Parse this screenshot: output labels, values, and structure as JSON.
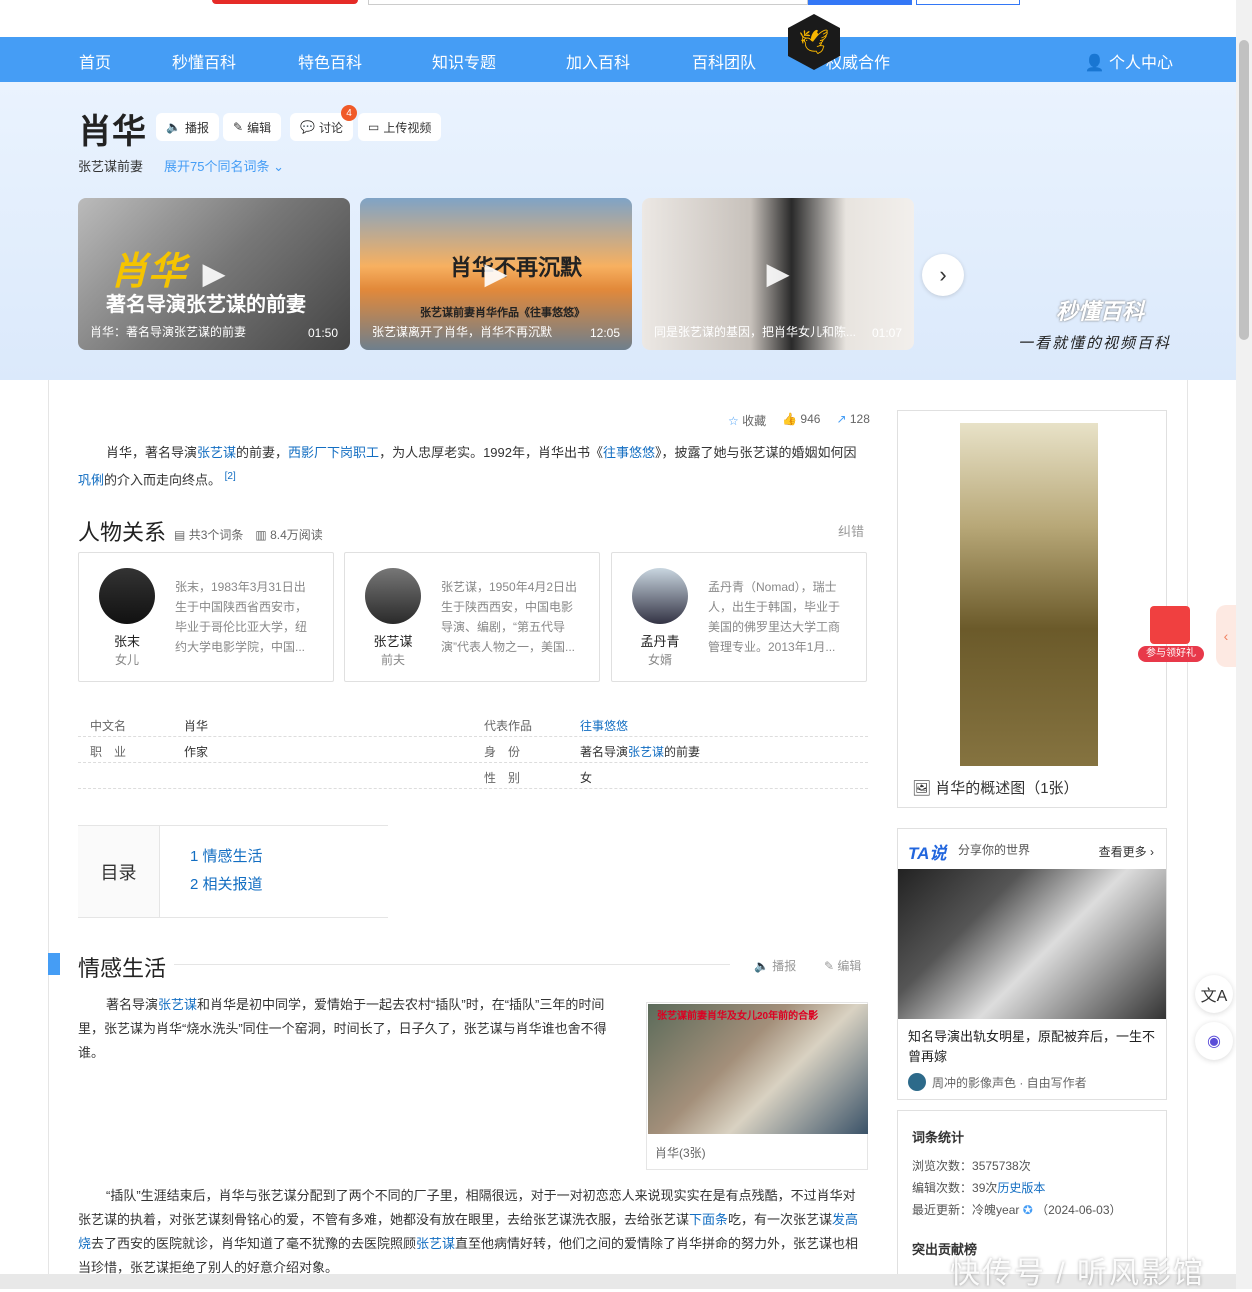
{
  "nav": {
    "items": [
      "首页",
      "秒懂百科",
      "特色百科",
      "知识专题",
      "加入百科",
      "百科团队",
      "权威合作"
    ],
    "user": "个人中心"
  },
  "entry": {
    "title": "肖华",
    "buttons": {
      "broadcast": "播报",
      "edit": "编辑",
      "discuss": "讨论",
      "upload": "上传视频"
    },
    "discuss_badge": "4",
    "subtitle": "张艺谋前妻",
    "expand": "展开75个同名词条"
  },
  "videos": [
    {
      "big1": "肖华",
      "big2": "著名导演张艺谋的前妻",
      "caption": "肖华：著名导演张艺谋的前妻",
      "duration": "01:50"
    },
    {
      "big1": "肖华不再沉默",
      "big2": "张艺谋前妻肖华作品《往事悠悠》",
      "caption": "张艺谋离开了肖华，肖华不再沉默",
      "duration": "12:05"
    },
    {
      "caption": "同是张艺谋的基因，把肖华女儿和陈...",
      "duration": "01:07"
    }
  ],
  "miaodong": {
    "logo": "秒懂百科",
    "slogan": "一看就懂的视频百科"
  },
  "stats": {
    "favorite": "收藏",
    "likes": "946",
    "shares": "128"
  },
  "intro": {
    "p1": "肖华，著名导演",
    "link1": "张艺谋",
    "p2": "的前妻，",
    "link2": "西影厂下岗职工",
    "p3": "，为人忠厚老实。1992年，肖华出书《",
    "link3": "往事悠悠",
    "p4": "》，披露了她与张艺谋的婚姻如何因",
    "link4": "巩俐",
    "p5": "的介入而走向终点。",
    "ref": "[2]"
  },
  "relations": {
    "title": "人物关系",
    "count": "共3个词条",
    "reads": "8.4万阅读",
    "correct": "纠错",
    "people": [
      {
        "name": "张末",
        "role": "女儿",
        "desc": "张末，1983年3月31日出生于中国陕西省西安市，毕业于哥伦比亚大学，纽约大学电影学院，中国..."
      },
      {
        "name": "张艺谋",
        "role": "前夫",
        "desc": "张艺谋，1950年4月2日出生于陕西西安，中国电影导演、编剧，“第五代导演”代表人物之一，美国..."
      },
      {
        "name": "孟丹青",
        "role": "女婿",
        "desc": "孟丹青（Nomad），瑞士人，出生于韩国，毕业于美国的佛罗里达大学工商管理专业。2013年1月..."
      }
    ]
  },
  "infobox": {
    "k_cn": "中文名",
    "v_cn": "肖华",
    "k_work": "代表作品",
    "v_work": "往事悠悠",
    "k_job": "职　业",
    "v_job": "作家",
    "k_id": "身　份",
    "v_id_pre": "著名导演",
    "v_id_link": "张艺谋",
    "v_id_post": "的前妻",
    "k_sex": "性　别",
    "v_sex": "女"
  },
  "toc": {
    "label": "目录",
    "items": [
      "1  情感生活",
      "2  相关报道"
    ]
  },
  "section1": {
    "title": "情感生活",
    "broadcast": "播报",
    "edit": "编辑",
    "para1_pre": "著名导演",
    "para1_link": "张艺谋",
    "para1_post": "和肖华是初中同学，爱情始于一起去农村“插队”时，在“插队”三年的时间里，张艺谋为肖华“烧水洗头”同住一个窑洞，时间长了，日子久了，张艺谋与肖华谁也舍不得谁。",
    "photo_caption": "肖华(3张)",
    "photo_overlay": "张艺谋前妻肖华及女儿20年前的合影",
    "para2_a": "“插队”生涯结束后，肖华与张艺谋分配到了两个不同的厂子里，相隔很远，对于一对初恋恋人来说现实实在是有点残酷，不过肖华对张艺谋的执着，对张艺谋刻骨铭心的爱，不管有多难，她都没有放在眼里，去给张艺谋洗衣服，去给张艺谋",
    "para2_link1": "下面条",
    "para2_b": "吃，有一次张艺谋",
    "para2_link2": "发高烧",
    "para2_c": "去了西安的医院就诊，肖华知道了毫不犹豫的去医院照顾",
    "para2_link3": "张艺谋",
    "para2_d": "直至他病情好转，他们之间的爱情除了肖华拼命的努力外，张艺谋也相当珍惜，张艺谋拒绝了别人的好意介绍对象。"
  },
  "sidebar": {
    "overview_caption": "肖华的概述图（1张）",
    "ta": {
      "logo": "TA说",
      "sub": "分享你的世界",
      "more": "查看更多",
      "title": "知名导演出轨女明星，原配被弃后，一生不曾再嫁",
      "author": "周冲的影像声色 · 自由写作者"
    },
    "stats": {
      "title": "词条统计",
      "views_k": "浏览次数：",
      "views_v": "3575738次",
      "edits_k": "编辑次数：",
      "edits_v": "39次",
      "edits_link": "历史版本",
      "updated_k": "最近更新：",
      "updated_user": "冷魄year",
      "updated_date": "（2024-06-03）",
      "contrib": "突出贡献榜"
    }
  },
  "float": {
    "gift": "参与领好礼",
    "side": "‹"
  },
  "watermark": "快传号 / 听风影馆"
}
